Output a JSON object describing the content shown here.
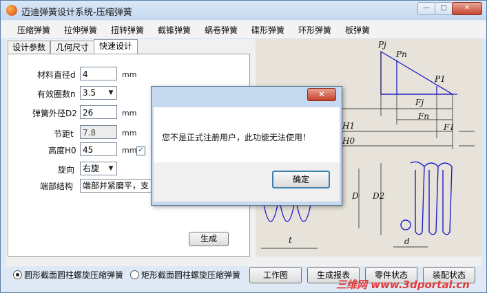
{
  "window": {
    "title": "迈迪弹簧设计系统-压缩弹簧",
    "minimize": "—",
    "maximize": "□",
    "close": "✕"
  },
  "menu": [
    "压缩弹簧",
    "拉伸弹簧",
    "扭转弹簧",
    "截锥弹簧",
    "蜗卷弹簧",
    "碟形弹簧",
    "环形弹簧",
    "板弹簧"
  ],
  "tabs": [
    "设计参数",
    "几何尺寸",
    "快速设计"
  ],
  "form": {
    "wire_diameter": {
      "label": "材料直径d",
      "value": "4",
      "unit": "mm"
    },
    "active_coils": {
      "label": "有效圈数n",
      "value": "3.5"
    },
    "outer_diameter": {
      "label": "弹簧外径D2",
      "value": "26",
      "unit": "mm"
    },
    "pitch": {
      "label": "节距t",
      "value": "7.8",
      "unit": "mm"
    },
    "height": {
      "label": "高度H0",
      "value": "45",
      "unit": "mm"
    },
    "direction": {
      "label": "旋向",
      "value": "右旋"
    },
    "end_structure": {
      "label": "端部结构",
      "value": "端部并紧磨平，支"
    },
    "generate_button": "生成"
  },
  "drawing": {
    "labels": [
      "Pj",
      "Pn",
      "P1",
      "Fj",
      "Fn",
      "F1",
      "H1",
      "H0",
      "D",
      "D2",
      "t",
      "d"
    ]
  },
  "bottom": {
    "option1": "圆形截面圆柱螺旋压缩弹簧",
    "option2": "矩形截面圆柱螺旋压缩弹簧",
    "buttons": [
      "工作图",
      "生成报表",
      "零件状态",
      "装配状态"
    ]
  },
  "dialog": {
    "message": "您不是正式注册用户，此功能无法使用！",
    "ok": "确定",
    "close": "✕"
  },
  "watermark": "三维网 www.3dportal.cn"
}
